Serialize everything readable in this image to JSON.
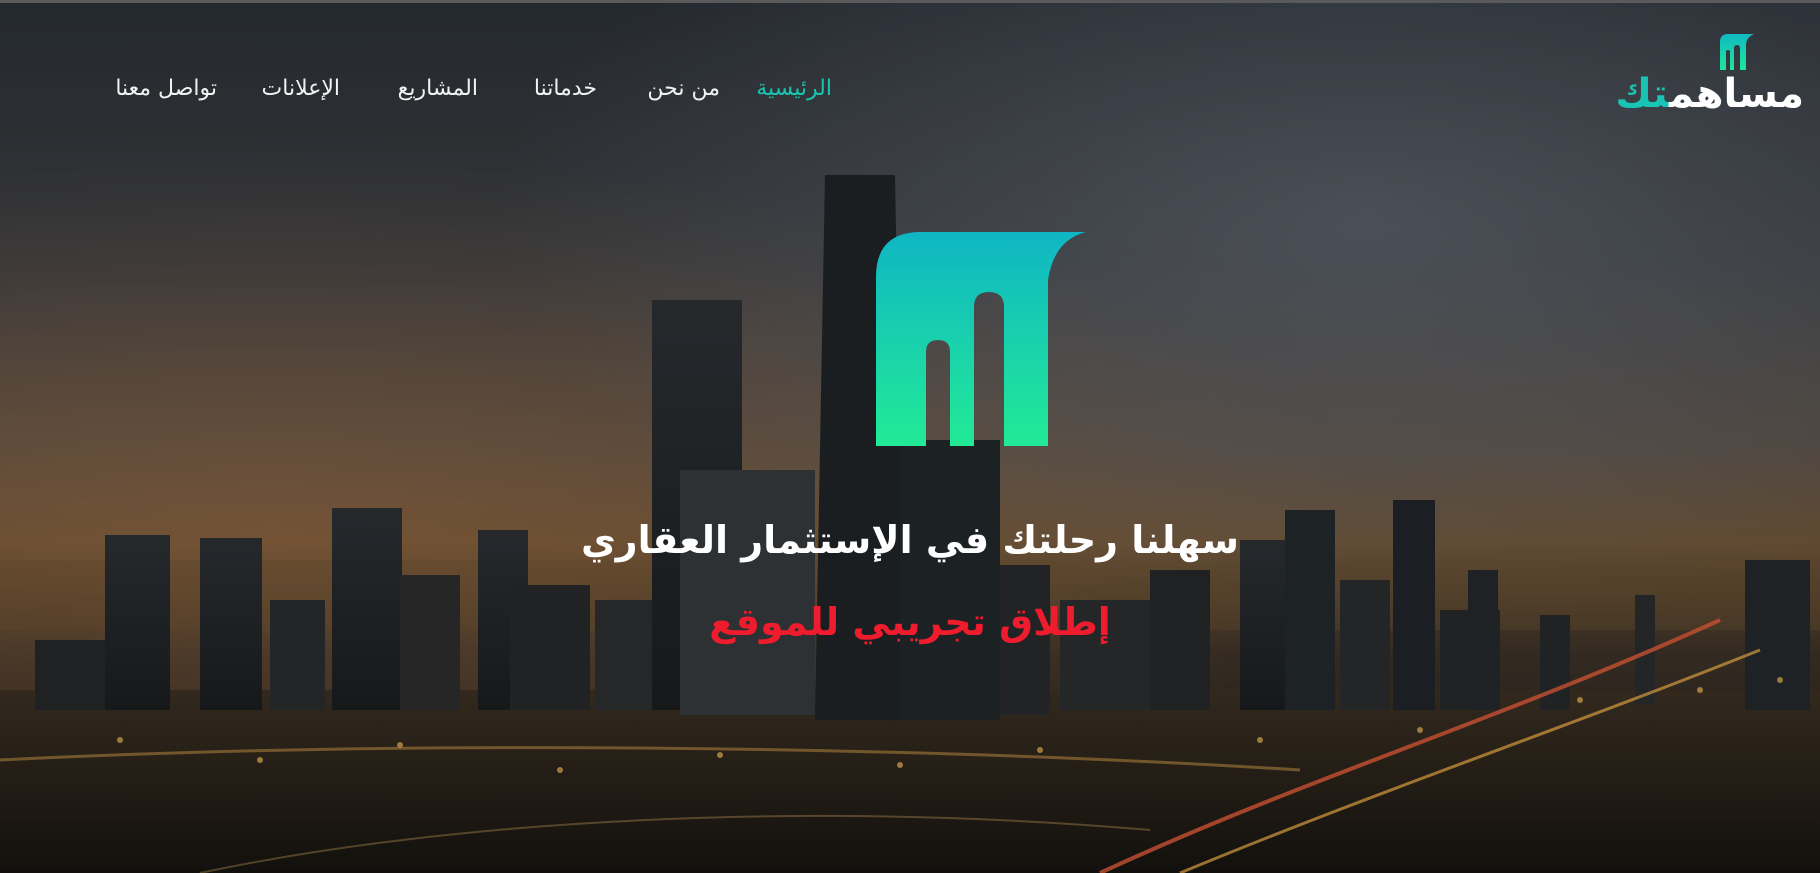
{
  "brand": {
    "name_main": "مساهم",
    "name_accent": "تك",
    "icon": "brand-arch-icon",
    "colors": {
      "accent": "#19c4b4",
      "gradient_top": "#12b9c2",
      "gradient_bottom": "#1fe69a"
    }
  },
  "nav": {
    "items": [
      {
        "label": "الرئيسية",
        "active": true
      },
      {
        "label": "من نحن",
        "active": false
      },
      {
        "label": "خدماتنا",
        "active": false
      },
      {
        "label": "المشاريع",
        "active": false
      },
      {
        "label": "الإعلانات",
        "active": false
      },
      {
        "label": "تواصل معنا",
        "active": false
      }
    ],
    "active_color": "#18c6b0"
  },
  "hero": {
    "logo_icon": "arch-logo-icon",
    "headline": "سهلنا رحلتك في الإستثمار العقاري",
    "subline": "إطلاق تجريبي للموقع",
    "subline_color": "#ee1c2c",
    "background": "city-skyline-dusk"
  }
}
